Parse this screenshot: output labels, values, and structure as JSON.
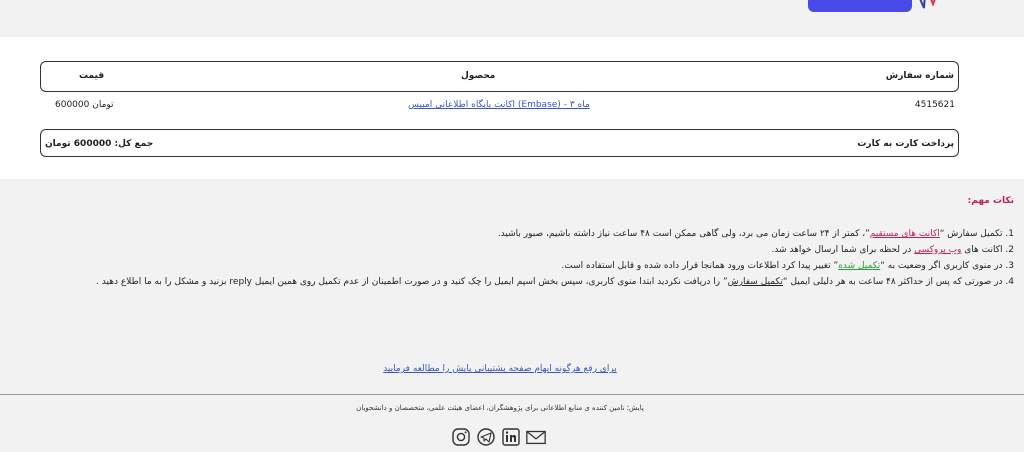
{
  "table": {
    "headers": {
      "order_number": "شماره سفارش",
      "product": "محصول",
      "price": "قیمت"
    },
    "rows": [
      {
        "order_number": "4515621",
        "product": "اکانت پایگاه اطلاعاتی امبیس (Embase) - ۳ ماه",
        "price": "600000 تومان"
      }
    ],
    "payment_method": "پرداخت کارت به کارت",
    "total": "جمع کل: 600000 تومان"
  },
  "notes": {
    "title": "نکات مهم:",
    "items": [
      {
        "num": "1.",
        "a": "تکمیل سفارش “",
        "link": "اکانت های مستقیم",
        "b": "”، کمتر از ۲۴ ساعت زمان می برد، ولی گاهی ممکن است ۴۸ ساعت نیاز داشته باشیم، صبور باشید."
      },
      {
        "num": "2.",
        "a": "اکانت های ",
        "link": "وب پروکسی",
        "b": " در لحظه برای شما ارسال خواهد شد."
      },
      {
        "num": "3.",
        "a": "در منوی کاربری اگر وضعیت به “",
        "link": "تکمیل شده",
        "b": "” تغییر پیدا کرد اطلاعات ورود همانجا قرار داده شده و قابل استفاده است."
      },
      {
        "num": "4.",
        "a": "در صورتی که پس از حداکثر ۴۸ ساعت به هر دلیلی ایمیل “",
        "link": "تکمیل سفارش",
        "b": "” را دریافت نکردید ابتدا منوی کاربری، سپس بخش اسپم ایمیل را چک کنید و در صورت اطمینان از عدم تکمیل روی همین ایمیل reply بزنید و مشکل را به ما اطلاع دهید ."
      }
    ]
  },
  "privacy_link": "برای رفع هرگونه ابهام صفحه پشتیبانی پایش را مطالعه فرمایید",
  "footer": {
    "tagline": "پایش؛ تامین کننده ی منابع اطلاعاتی برای پژوهشگران، اعضای هیئت علمی، متخصصان و دانشجویان",
    "icons": [
      "instagram-icon",
      "telegram-icon",
      "linkedin-icon",
      "mail-icon"
    ]
  }
}
